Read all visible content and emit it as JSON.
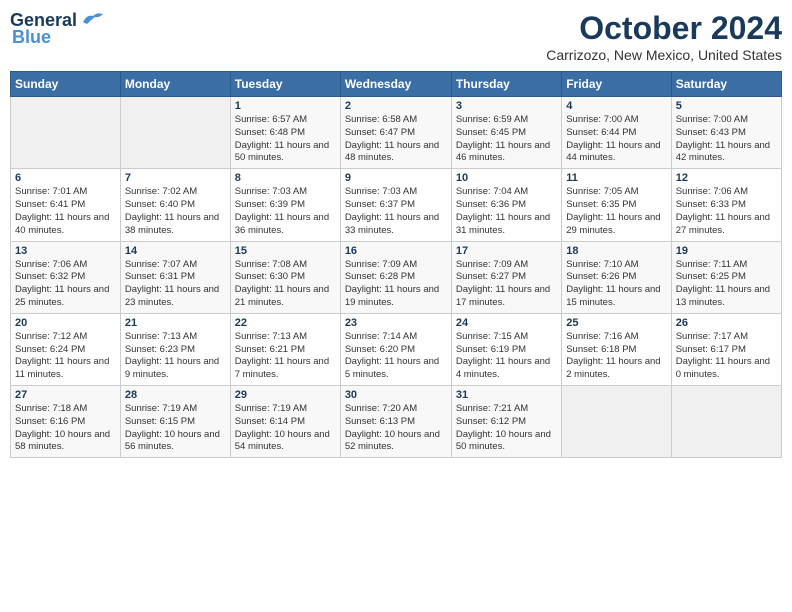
{
  "header": {
    "logo_line1": "General",
    "logo_line2": "Blue",
    "month": "October 2024",
    "location": "Carrizozo, New Mexico, United States"
  },
  "days_of_week": [
    "Sunday",
    "Monday",
    "Tuesday",
    "Wednesday",
    "Thursday",
    "Friday",
    "Saturday"
  ],
  "weeks": [
    [
      {
        "day": "",
        "sunrise": "",
        "sunset": "",
        "daylight": ""
      },
      {
        "day": "",
        "sunrise": "",
        "sunset": "",
        "daylight": ""
      },
      {
        "day": "1",
        "sunrise": "Sunrise: 6:57 AM",
        "sunset": "Sunset: 6:48 PM",
        "daylight": "Daylight: 11 hours and 50 minutes."
      },
      {
        "day": "2",
        "sunrise": "Sunrise: 6:58 AM",
        "sunset": "Sunset: 6:47 PM",
        "daylight": "Daylight: 11 hours and 48 minutes."
      },
      {
        "day": "3",
        "sunrise": "Sunrise: 6:59 AM",
        "sunset": "Sunset: 6:45 PM",
        "daylight": "Daylight: 11 hours and 46 minutes."
      },
      {
        "day": "4",
        "sunrise": "Sunrise: 7:00 AM",
        "sunset": "Sunset: 6:44 PM",
        "daylight": "Daylight: 11 hours and 44 minutes."
      },
      {
        "day": "5",
        "sunrise": "Sunrise: 7:00 AM",
        "sunset": "Sunset: 6:43 PM",
        "daylight": "Daylight: 11 hours and 42 minutes."
      }
    ],
    [
      {
        "day": "6",
        "sunrise": "Sunrise: 7:01 AM",
        "sunset": "Sunset: 6:41 PM",
        "daylight": "Daylight: 11 hours and 40 minutes."
      },
      {
        "day": "7",
        "sunrise": "Sunrise: 7:02 AM",
        "sunset": "Sunset: 6:40 PM",
        "daylight": "Daylight: 11 hours and 38 minutes."
      },
      {
        "day": "8",
        "sunrise": "Sunrise: 7:03 AM",
        "sunset": "Sunset: 6:39 PM",
        "daylight": "Daylight: 11 hours and 36 minutes."
      },
      {
        "day": "9",
        "sunrise": "Sunrise: 7:03 AM",
        "sunset": "Sunset: 6:37 PM",
        "daylight": "Daylight: 11 hours and 33 minutes."
      },
      {
        "day": "10",
        "sunrise": "Sunrise: 7:04 AM",
        "sunset": "Sunset: 6:36 PM",
        "daylight": "Daylight: 11 hours and 31 minutes."
      },
      {
        "day": "11",
        "sunrise": "Sunrise: 7:05 AM",
        "sunset": "Sunset: 6:35 PM",
        "daylight": "Daylight: 11 hours and 29 minutes."
      },
      {
        "day": "12",
        "sunrise": "Sunrise: 7:06 AM",
        "sunset": "Sunset: 6:33 PM",
        "daylight": "Daylight: 11 hours and 27 minutes."
      }
    ],
    [
      {
        "day": "13",
        "sunrise": "Sunrise: 7:06 AM",
        "sunset": "Sunset: 6:32 PM",
        "daylight": "Daylight: 11 hours and 25 minutes."
      },
      {
        "day": "14",
        "sunrise": "Sunrise: 7:07 AM",
        "sunset": "Sunset: 6:31 PM",
        "daylight": "Daylight: 11 hours and 23 minutes."
      },
      {
        "day": "15",
        "sunrise": "Sunrise: 7:08 AM",
        "sunset": "Sunset: 6:30 PM",
        "daylight": "Daylight: 11 hours and 21 minutes."
      },
      {
        "day": "16",
        "sunrise": "Sunrise: 7:09 AM",
        "sunset": "Sunset: 6:28 PM",
        "daylight": "Daylight: 11 hours and 19 minutes."
      },
      {
        "day": "17",
        "sunrise": "Sunrise: 7:09 AM",
        "sunset": "Sunset: 6:27 PM",
        "daylight": "Daylight: 11 hours and 17 minutes."
      },
      {
        "day": "18",
        "sunrise": "Sunrise: 7:10 AM",
        "sunset": "Sunset: 6:26 PM",
        "daylight": "Daylight: 11 hours and 15 minutes."
      },
      {
        "day": "19",
        "sunrise": "Sunrise: 7:11 AM",
        "sunset": "Sunset: 6:25 PM",
        "daylight": "Daylight: 11 hours and 13 minutes."
      }
    ],
    [
      {
        "day": "20",
        "sunrise": "Sunrise: 7:12 AM",
        "sunset": "Sunset: 6:24 PM",
        "daylight": "Daylight: 11 hours and 11 minutes."
      },
      {
        "day": "21",
        "sunrise": "Sunrise: 7:13 AM",
        "sunset": "Sunset: 6:23 PM",
        "daylight": "Daylight: 11 hours and 9 minutes."
      },
      {
        "day": "22",
        "sunrise": "Sunrise: 7:13 AM",
        "sunset": "Sunset: 6:21 PM",
        "daylight": "Daylight: 11 hours and 7 minutes."
      },
      {
        "day": "23",
        "sunrise": "Sunrise: 7:14 AM",
        "sunset": "Sunset: 6:20 PM",
        "daylight": "Daylight: 11 hours and 5 minutes."
      },
      {
        "day": "24",
        "sunrise": "Sunrise: 7:15 AM",
        "sunset": "Sunset: 6:19 PM",
        "daylight": "Daylight: 11 hours and 4 minutes."
      },
      {
        "day": "25",
        "sunrise": "Sunrise: 7:16 AM",
        "sunset": "Sunset: 6:18 PM",
        "daylight": "Daylight: 11 hours and 2 minutes."
      },
      {
        "day": "26",
        "sunrise": "Sunrise: 7:17 AM",
        "sunset": "Sunset: 6:17 PM",
        "daylight": "Daylight: 11 hours and 0 minutes."
      }
    ],
    [
      {
        "day": "27",
        "sunrise": "Sunrise: 7:18 AM",
        "sunset": "Sunset: 6:16 PM",
        "daylight": "Daylight: 10 hours and 58 minutes."
      },
      {
        "day": "28",
        "sunrise": "Sunrise: 7:19 AM",
        "sunset": "Sunset: 6:15 PM",
        "daylight": "Daylight: 10 hours and 56 minutes."
      },
      {
        "day": "29",
        "sunrise": "Sunrise: 7:19 AM",
        "sunset": "Sunset: 6:14 PM",
        "daylight": "Daylight: 10 hours and 54 minutes."
      },
      {
        "day": "30",
        "sunrise": "Sunrise: 7:20 AM",
        "sunset": "Sunset: 6:13 PM",
        "daylight": "Daylight: 10 hours and 52 minutes."
      },
      {
        "day": "31",
        "sunrise": "Sunrise: 7:21 AM",
        "sunset": "Sunset: 6:12 PM",
        "daylight": "Daylight: 10 hours and 50 minutes."
      },
      {
        "day": "",
        "sunrise": "",
        "sunset": "",
        "daylight": ""
      },
      {
        "day": "",
        "sunrise": "",
        "sunset": "",
        "daylight": ""
      }
    ]
  ]
}
